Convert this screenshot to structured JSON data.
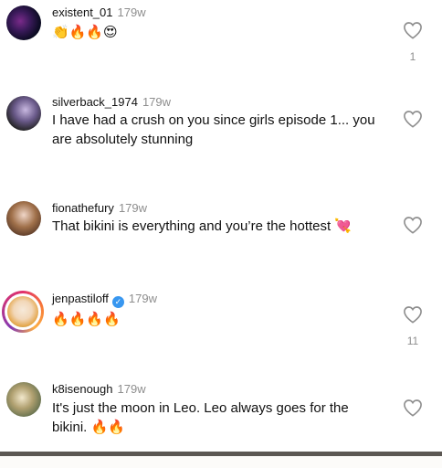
{
  "comments": [
    {
      "username": "existent_01",
      "time": "179w",
      "text": "👏🔥🔥😍",
      "likes": "1",
      "verified": false
    },
    {
      "username": "silverback_1974",
      "time": "179w",
      "text": "I have had a crush on you since girls episode 1... you are absolutely stunning",
      "likes": "",
      "verified": false
    },
    {
      "username": "fionathefury",
      "time": "179w",
      "text": "That bikini is everything and you’re the hottest 💘",
      "likes": "",
      "verified": false
    },
    {
      "username": "jenpastiloff",
      "time": "179w",
      "text": "🔥🔥🔥🔥",
      "likes": "11",
      "verified": true
    },
    {
      "username": "k8isenough",
      "time": "179w",
      "text": "It's just the moon in Leo. Leo always goes for the bikini. 🔥🔥",
      "likes": "",
      "verified": false
    }
  ],
  "icons": {
    "like": "heart-outline-icon",
    "verified": "verified-badge-icon"
  },
  "colors": {
    "secondary_text": "#8e8e8e",
    "verified": "#3897f0",
    "bottom_bar": "#5b5753"
  }
}
